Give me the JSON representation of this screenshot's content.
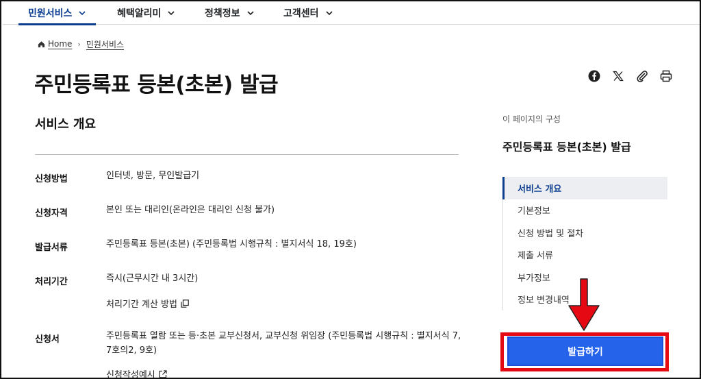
{
  "topnav": {
    "items": [
      {
        "label": "민원서비스",
        "active": true
      },
      {
        "label": "혜택알리미",
        "active": false
      },
      {
        "label": "정책정보",
        "active": false
      },
      {
        "label": "고객센터",
        "active": false
      }
    ]
  },
  "breadcrumb": {
    "home": "Home",
    "current": "민원서비스"
  },
  "page_title": "주민등록표 등본(초본) 발급",
  "share_icons": [
    "facebook-icon",
    "x-icon",
    "clip-icon",
    "print-icon"
  ],
  "overview": {
    "title": "서비스 개요",
    "rows": [
      {
        "label": "신청방법",
        "value": "인터넷, 방문, 무인발급기"
      },
      {
        "label": "신청자격",
        "value": "본인 또는 대리인(온라인은 대리인 신청 불가)"
      },
      {
        "label": "발급서류",
        "value": "주민등록표 등본(초본) (주민등록법 시행규칙 : 별지서식 18, 19호)"
      },
      {
        "label": "처리기간",
        "value": "즉시(근무시간 내 3시간)",
        "link": "처리기간 계산 방법"
      },
      {
        "label": "신청서",
        "value_line1": "주민등록표 열람 또는 등·초본 교부신청서, 교부신청 위임장 (주민등록법 시행규칙 : 별지서식 7,",
        "value_line2": "7호의2, 9호)",
        "link": "신청작성예시"
      }
    ]
  },
  "toc": {
    "caption": "이 페이지의 구성",
    "title": "주민등록표 등본(초본) 발급",
    "items": [
      "서비스 개요",
      "기본정보",
      "신청 방법 및 절차",
      "제출 서류",
      "부가정보",
      "정보 변경내역"
    ],
    "active_index": 0
  },
  "issue_button": "발급하기",
  "colors": {
    "primary": "#0b3d91",
    "button": "#2563eb",
    "annotation": "#e50914"
  }
}
